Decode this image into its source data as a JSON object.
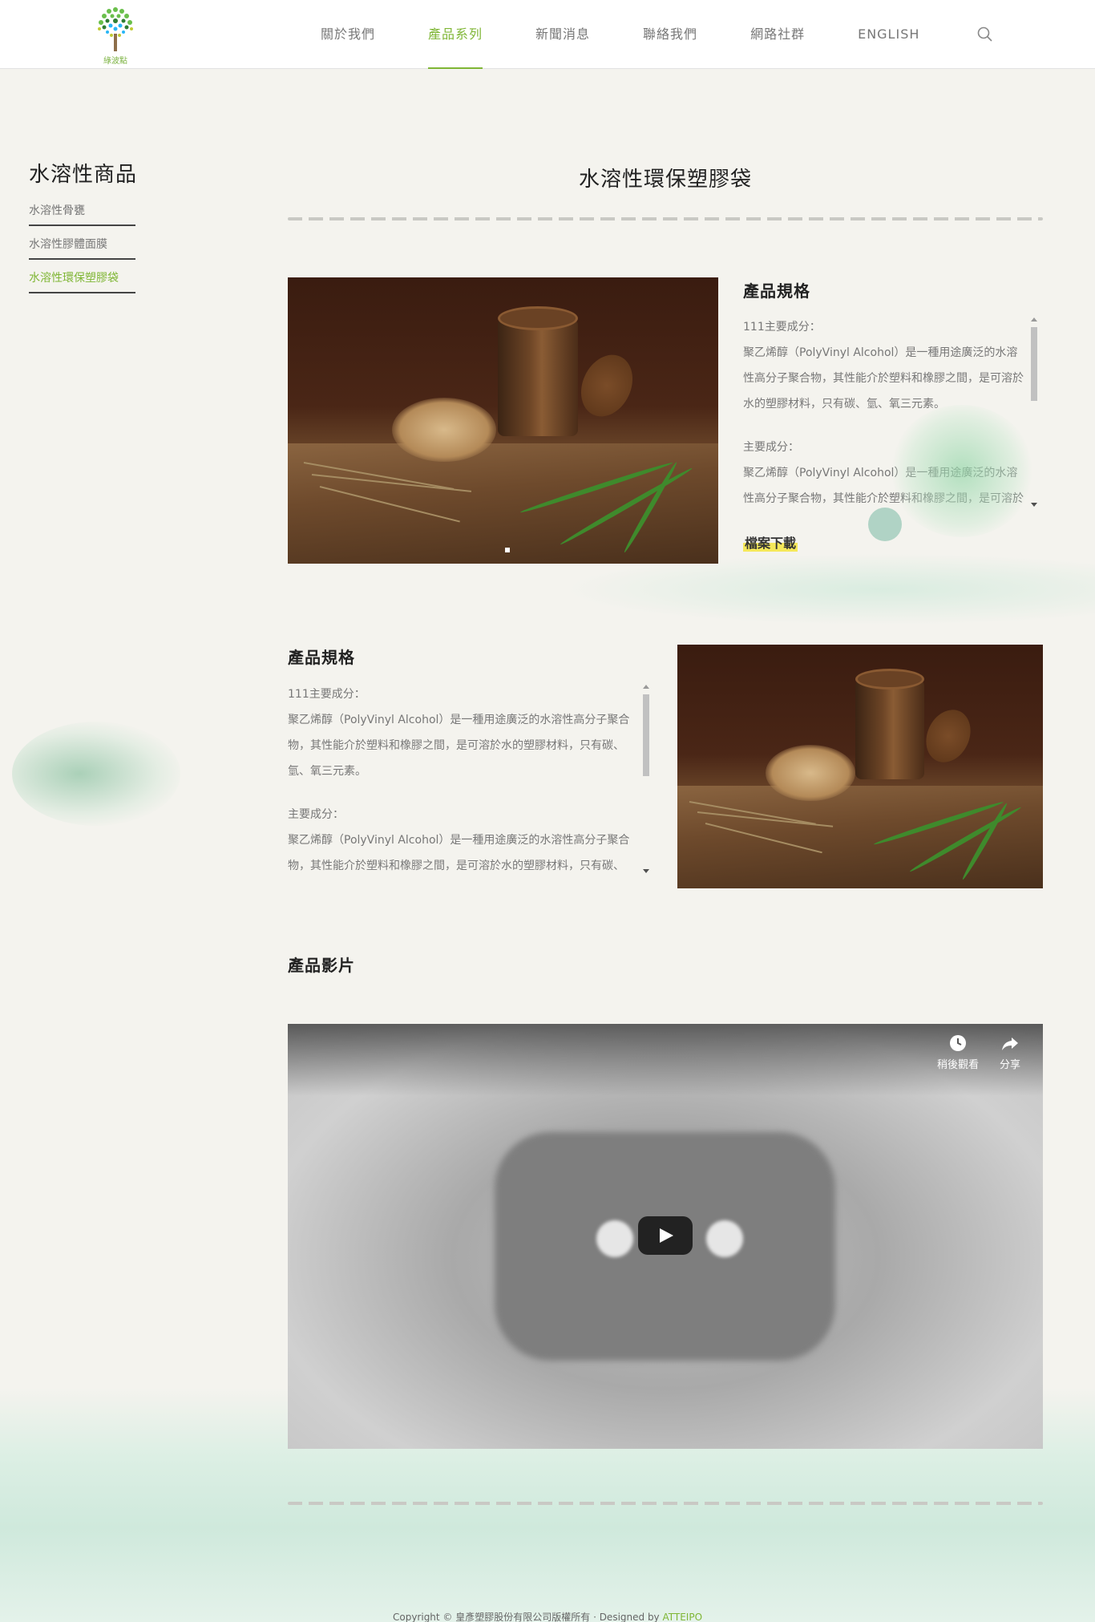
{
  "brand": {
    "logo_text": "綠波點"
  },
  "nav": {
    "items": [
      "關於我們",
      "產品系列",
      "新聞消息",
      "聯絡我們",
      "網路社群",
      "ENGLISH"
    ],
    "active_index": 1
  },
  "sidebar": {
    "title": "水溶性商品",
    "items": [
      {
        "label": "水溶性骨甕"
      },
      {
        "label": "水溶性膠體面膜"
      },
      {
        "label": "水溶性環保塑膠袋"
      }
    ],
    "active_index": 2
  },
  "main": {
    "title": "水溶性環保塑膠袋",
    "section1": {
      "spec_title": "產品規格",
      "paragraphs": [
        {
          "head": "111主要成分：",
          "body": "聚乙烯醇（PolyVinyl Alcohol）是一種用途廣泛的水溶性高分子聚合物，其性能介於塑料和橡膠之間，是可溶於水的塑膠材料，只有碳、氫、氧三元素。"
        },
        {
          "head": "主要成分：",
          "body": "聚乙烯醇（PolyVinyl Alcohol）是一種用途廣泛的水溶性高分子聚合物，其性能介於塑料和橡膠之間，是可溶於水的塑膠材料，只有碳、氫、氧三元素。"
        }
      ],
      "download_label": "檔案下載"
    },
    "section2": {
      "spec_title": "產品規格",
      "paragraphs": [
        {
          "head": "111主要成分：",
          "body": "聚乙烯醇（PolyVinyl Alcohol）是一種用途廣泛的水溶性高分子聚合物，其性能介於塑料和橡膠之間，是可溶於水的塑膠材料，只有碳、氫、氧三元素。"
        },
        {
          "head": "主要成分：",
          "body": "聚乙烯醇（PolyVinyl Alcohol）是一種用途廣泛的水溶性高分子聚合物，其性能介於塑料和橡膠之間，是可溶於水的塑膠材料，只有碳、氫、氧三元素。"
        }
      ]
    },
    "video": {
      "title": "產品影片",
      "watch_later_label": "稍後觀看",
      "share_label": "分享"
    }
  },
  "footer": {
    "copyright": "Copyright © 皇彥塑膠股份有限公司版權所有 · Designed by ",
    "designer": "ATTEIPO"
  },
  "colors": {
    "accent": "#7fb635",
    "highlight": "#f5e85a"
  }
}
